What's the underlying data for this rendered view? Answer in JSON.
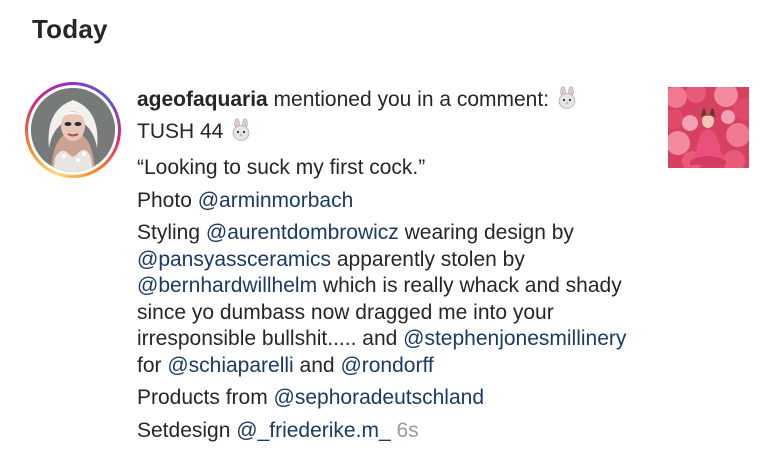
{
  "section": {
    "title": "Today"
  },
  "notification": {
    "username": "ageofaquaria",
    "action_text": " mentioned you in a comment: ",
    "line_tush": "TUSH 44 ",
    "quote": "“Looking to suck my first cock.”",
    "photo_prefix": "Photo ",
    "photo_handle": "@arminmorbach",
    "styling_prefix": "Styling ",
    "styling_handle": "@aurentdombrowicz",
    "styling_mid": " wearing design by ",
    "design_handle": "@pansyassceramics",
    "stolen_text": " apparently stolen by ",
    "stolen_handle": "@bernhardwillhelm",
    "complaint_text": " which is really whack and shady since yo dumbass now dragged me into your irresponsible bullshit..... and ",
    "millinery_handle": "@stephenjonesmillinery",
    "for_text": " for ",
    "schiaparelli_handle": "@schiaparelli",
    "and_text": " and ",
    "rondorff_handle": "@rondorff",
    "products_prefix": "Products from ",
    "products_handle": "@sephoradeutschland",
    "setdesign_prefix": "Setdesign ",
    "setdesign_handle": "@_friederike.m_",
    "timestamp": "6s"
  },
  "icons": {
    "avatar": "profile-avatar-drag-queen",
    "emoji": "rabbit-face-emoji",
    "thumbnail": "post-thumbnail-pink-balloons"
  },
  "colors": {
    "text": "#262626",
    "link": "#1a3a66",
    "timestamp": "#9a9a9a",
    "story_ring": [
      "#feda75",
      "#fa7e1e",
      "#d62976",
      "#962fbf",
      "#4f5bd5"
    ]
  }
}
